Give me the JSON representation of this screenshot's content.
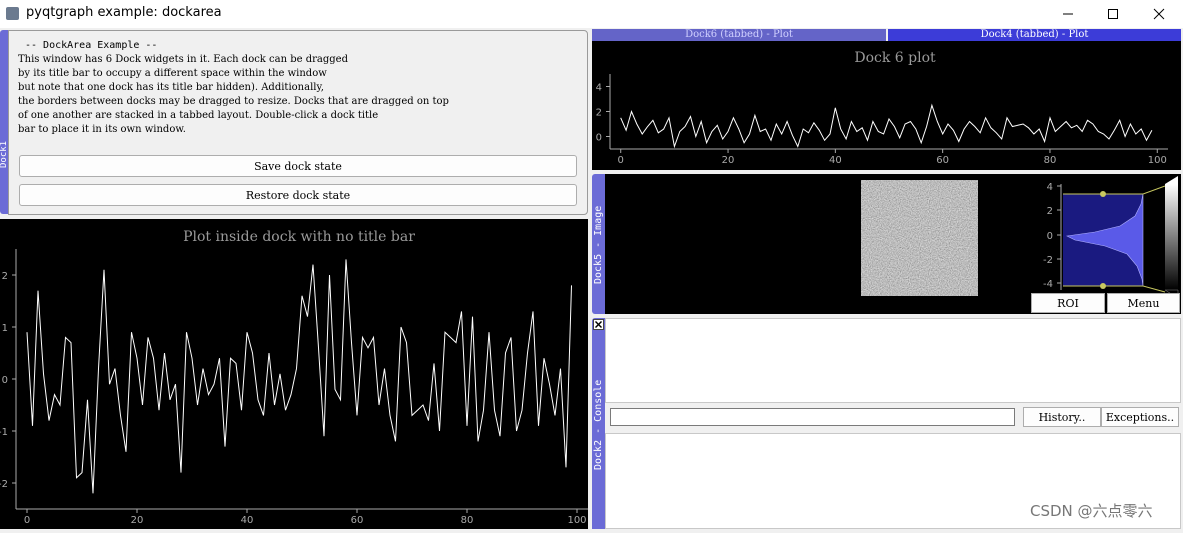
{
  "window": {
    "title": "pyqtgraph example: dockarea"
  },
  "dock1": {
    "label": "Dock1",
    "heading": "-- DockArea Example --",
    "description": [
      "This window has 6 Dock widgets in it. Each dock can be dragged",
      "by its title bar to occupy a different space within the window",
      "but note that one dock has its title bar hidden). Additionally,",
      "the borders between docks may be dragged to resize. Docks that are dragged on top",
      "of one another are stacked in a tabbed layout. Double-click a dock title",
      "bar to place it in its own window."
    ],
    "save_button": "Save dock state",
    "restore_button": "Restore dock state"
  },
  "dock3": {
    "plot_title": "Plot inside dock with no title bar",
    "x_ticks": [
      "0",
      "20",
      "40",
      "60",
      "80",
      "100"
    ],
    "y_ticks": [
      "2",
      "1",
      "0",
      "-1",
      "-2"
    ]
  },
  "tabs": {
    "tab6": "Dock6 (tabbed) - Plot",
    "tab4": "Dock4 (tabbed) - Plot"
  },
  "dock6": {
    "plot_title": "Dock 6 plot",
    "x_ticks": [
      "0",
      "20",
      "40",
      "60",
      "80",
      "100"
    ],
    "y_ticks": [
      "4",
      "2",
      "0"
    ]
  },
  "dock5": {
    "label": "Dock5 - Image",
    "hist_ticks": [
      "4",
      "2",
      "0",
      "-2",
      "-4"
    ],
    "roi_button": "ROI",
    "menu_button": "Menu"
  },
  "dock2": {
    "label": "Dock2 - Console",
    "history_button": "History..",
    "exceptions_button": "Exceptions..",
    "input_value": ""
  },
  "watermark": "CSDN @六点零六",
  "chart_data": [
    {
      "type": "line",
      "title": "Plot inside dock with no title bar",
      "xlabel": "",
      "ylabel": "",
      "xlim": [
        -2,
        102
      ],
      "ylim": [
        -2.5,
        2.5
      ],
      "x": [
        0,
        1,
        2,
        3,
        4,
        5,
        6,
        7,
        8,
        9,
        10,
        11,
        12,
        13,
        14,
        15,
        16,
        17,
        18,
        19,
        20,
        21,
        22,
        23,
        24,
        25,
        26,
        27,
        28,
        29,
        30,
        31,
        32,
        33,
        34,
        35,
        36,
        37,
        38,
        39,
        40,
        41,
        42,
        43,
        44,
        45,
        46,
        47,
        48,
        49,
        50,
        51,
        52,
        53,
        54,
        55,
        56,
        57,
        58,
        59,
        60,
        61,
        62,
        63,
        64,
        65,
        66,
        67,
        68,
        69,
        70,
        71,
        72,
        73,
        74,
        75,
        76,
        77,
        78,
        79,
        80,
        81,
        82,
        83,
        84,
        85,
        86,
        87,
        88,
        89,
        90,
        91,
        92,
        93,
        94,
        95,
        96,
        97,
        98,
        99
      ],
      "values": [
        0.9,
        -0.9,
        1.7,
        0.1,
        -0.8,
        -0.3,
        -0.5,
        0.8,
        0.7,
        -1.9,
        -1.8,
        -0.4,
        -2.2,
        0.2,
        2.1,
        -0.1,
        0.2,
        -0.7,
        -1.4,
        0.9,
        0.4,
        -0.5,
        0.8,
        0.4,
        -0.6,
        0.5,
        -0.4,
        -0.1,
        -1.8,
        0.9,
        0.4,
        -0.5,
        0.2,
        -0.3,
        -0.1,
        0.4,
        -1.3,
        0.4,
        0.3,
        -0.6,
        0.9,
        0.5,
        -0.4,
        -0.7,
        0.5,
        -0.5,
        0.1,
        -0.6,
        -0.3,
        0.2,
        1.6,
        1.2,
        2.2,
        0.6,
        -1.1,
        2.0,
        -0.2,
        -0.4,
        2.3,
        0.7,
        -0.7,
        0.8,
        0.6,
        0.8,
        -0.5,
        0.2,
        -0.7,
        -1.2,
        1.0,
        0.7,
        -0.7,
        -0.6,
        -0.5,
        -0.8,
        0.3,
        -1.0,
        0.9,
        0.8,
        0.7,
        1.3,
        -0.9,
        1.2,
        -1.2,
        -0.6,
        0.9,
        -0.6,
        -1.1,
        0.5,
        0.8,
        -1.0,
        -0.6,
        0.5,
        1.3,
        -0.9,
        0.4,
        -0.1,
        -0.7,
        0.2,
        -1.7,
        1.8
      ]
    },
    {
      "type": "line",
      "title": "Dock 6 plot",
      "xlabel": "",
      "ylabel": "",
      "xlim": [
        -2,
        102
      ],
      "ylim": [
        -1,
        5
      ],
      "x": [
        0,
        1,
        2,
        3,
        4,
        5,
        6,
        7,
        8,
        9,
        10,
        11,
        12,
        13,
        14,
        15,
        16,
        17,
        18,
        19,
        20,
        21,
        22,
        23,
        24,
        25,
        26,
        27,
        28,
        29,
        30,
        31,
        32,
        33,
        34,
        35,
        36,
        37,
        38,
        39,
        40,
        41,
        42,
        43,
        44,
        45,
        46,
        47,
        48,
        49,
        50,
        51,
        52,
        53,
        54,
        55,
        56,
        57,
        58,
        59,
        60,
        61,
        62,
        63,
        64,
        65,
        66,
        67,
        68,
        69,
        70,
        71,
        72,
        73,
        74,
        75,
        76,
        77,
        78,
        79,
        80,
        81,
        82,
        83,
        84,
        85,
        86,
        87,
        88,
        89,
        90,
        91,
        92,
        93,
        94,
        95,
        96,
        97,
        98,
        99
      ],
      "values": [
        1.5,
        0.5,
        2.0,
        1.0,
        0.2,
        0.8,
        1.3,
        0.3,
        0.6,
        1.5,
        -0.8,
        0.4,
        0.8,
        1.6,
        0.0,
        1.2,
        -0.5,
        0.4,
        0.9,
        -0.2,
        0.4,
        1.5,
        0.6,
        -0.5,
        0.2,
        1.7,
        0.4,
        0.6,
        -0.3,
        1.0,
        0.2,
        1.2,
        0.1,
        -0.8,
        0.6,
        0.3,
        1.1,
        0.5,
        -0.3,
        0.2,
        2.3,
        0.6,
        -0.2,
        1.2,
        0.4,
        0.7,
        -0.3,
        1.2,
        0.4,
        0.2,
        1.4,
        0.8,
        -0.1,
        1.0,
        1.2,
        0.6,
        -0.5,
        0.8,
        2.5,
        1.2,
        0.2,
        1.0,
        0.5,
        -0.4,
        0.6,
        1.2,
        0.8,
        0.3,
        1.5,
        0.7,
        0.3,
        -0.2,
        1.5,
        0.8,
        0.9,
        1.0,
        0.7,
        0.2,
        0.6,
        -0.4,
        1.5,
        0.4,
        0.8,
        1.2,
        0.7,
        0.9,
        0.4,
        1.3,
        1.0,
        0.4,
        0.2,
        -0.2,
        0.5,
        1.3,
        0.0,
        1.0,
        0.2,
        0.6,
        -0.3,
        0.5
      ]
    }
  ]
}
